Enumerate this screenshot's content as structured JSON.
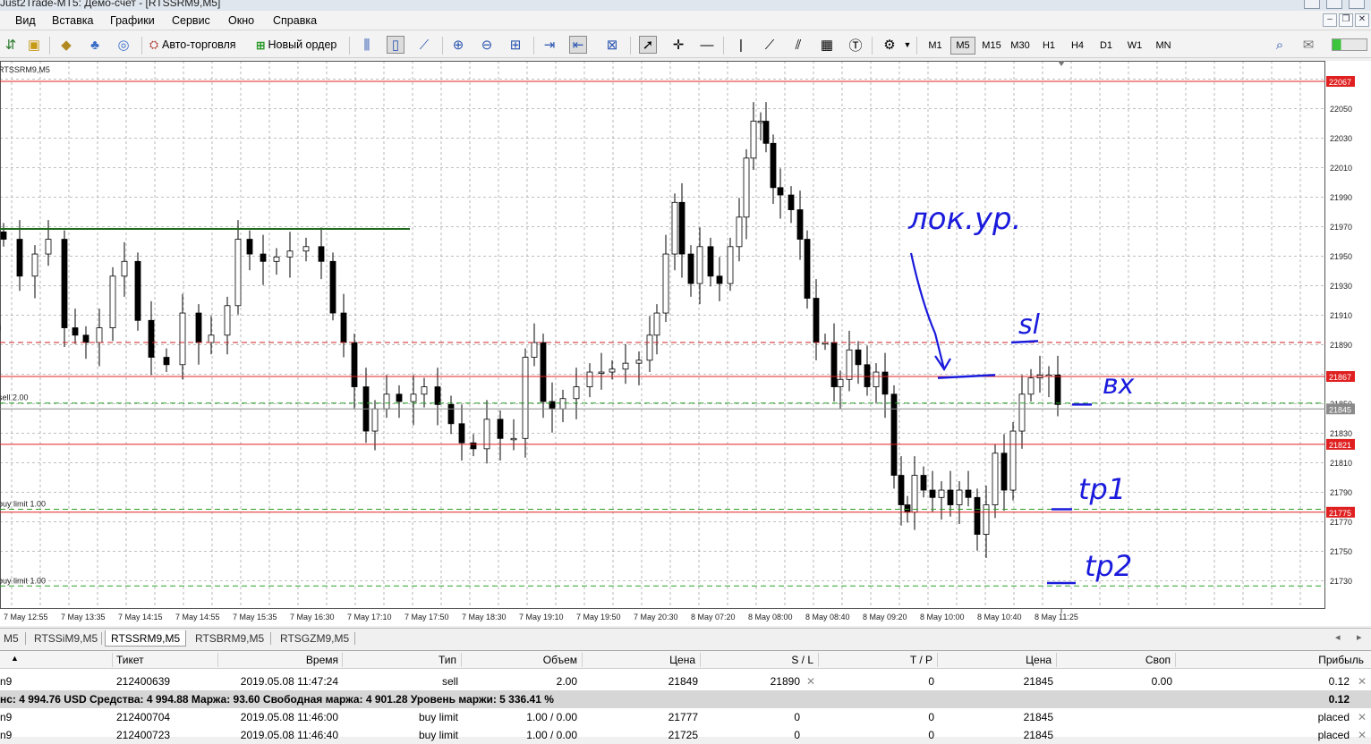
{
  "window": {
    "title": "Just2Trade-MT5: Демо-счет - [RTSSRM9,M5]"
  },
  "menu": [
    "Вид",
    "Вставка",
    "Графики",
    "Сервис",
    "Окно",
    "Справка"
  ],
  "toolbar": {
    "auto_trading": "Авто-торговля",
    "new_order": "Новый ордер",
    "timeframes": [
      "M1",
      "M5",
      "M15",
      "M30",
      "H1",
      "H4",
      "D1",
      "W1",
      "MN"
    ],
    "active_timeframe": "M5"
  },
  "chart": {
    "symbol_label": "RTSSRM9,M5",
    "price_labels": [
      "22070",
      "22050",
      "22030",
      "22010",
      "21990",
      "21970",
      "21950",
      "21930",
      "21910",
      "21890",
      "21870",
      "21850",
      "21830",
      "21810",
      "21790",
      "21770",
      "21750",
      "21730"
    ],
    "time_labels": [
      "7 May 12:55",
      "7 May 13:35",
      "7 May 14:15",
      "7 May 14:55",
      "7 May 15:35",
      "7 May 16:30",
      "7 May 17:10",
      "7 May 17:50",
      "7 May 18:30",
      "7 May 19:10",
      "7 May 19:50",
      "7 May 20:30",
      "8 May 07:20",
      "8 May 08:00",
      "8 May 08:40",
      "8 May 09:20",
      "8 May 10:00",
      "8 May 10:40",
      "8 May 11:25"
    ],
    "levels": [
      {
        "price": 22067,
        "label": "22067",
        "color": "#e02020",
        "style": "solid"
      },
      {
        "price": 21890,
        "label": "",
        "color": "#cc2020",
        "style": "dash"
      },
      {
        "price": 21867,
        "label": "21867",
        "color": "#e02020",
        "style": "solid"
      },
      {
        "price": 21845,
        "label": "21845",
        "color": "#8a8a8a",
        "style": "solid"
      },
      {
        "price": 21821,
        "label": "21821",
        "color": "#e02020",
        "style": "solid"
      },
      {
        "price": 21775,
        "label": "21775",
        "color": "#e02020",
        "style": "solid"
      }
    ],
    "order_lines": [
      {
        "price": 21849,
        "label": "sell 2.00",
        "color": "#2aa02a"
      },
      {
        "price": 21777,
        "label": "buy limit 1.00",
        "color": "#2aa02a"
      },
      {
        "price": 21725,
        "label": "buy limit 1.00",
        "color": "#2aa02a"
      }
    ],
    "left_marker": "l",
    "colors": {
      "bull": "#ffffff",
      "bear": "#000000",
      "grid": "#9a9a9a",
      "hline": "#1d6a1d",
      "ink": "#1a1adc"
    }
  },
  "handwriting": {
    "level_note": "лок.ур.",
    "sl": "sl",
    "entry": "вх",
    "tp1": "tp1",
    "tp2": "tp2"
  },
  "tabs": [
    "M5",
    "RTSSiM9,M5",
    "RTSSRM9,M5",
    "RTSBRM9,M5",
    "RTSGZM9,M5"
  ],
  "active_tab": "RTSSRM9,M5",
  "terminal": {
    "columns": [
      "Тикет",
      "Время",
      "Тип",
      "Объем",
      "Цена",
      "S / L",
      "T / P",
      "Цена",
      "Своп",
      "Прибыль"
    ],
    "rows": [
      {
        "symbol": "n9",
        "ticket": "212400639",
        "time": "2019.05.08 11:47:24",
        "type": "sell",
        "volume": "2.00",
        "price": "21849",
        "sl": "21890",
        "tp": "0",
        "cur": "21845",
        "swap": "0.00",
        "profit": "0.12"
      },
      {
        "symbol": "n9",
        "ticket": "212400704",
        "time": "2019.05.08 11:46:00",
        "type": "buy limit",
        "volume": "1.00 / 0.00",
        "price": "21777",
        "sl": "0",
        "tp": "0",
        "cur": "21845",
        "swap": "",
        "profit": "placed"
      },
      {
        "symbol": "n9",
        "ticket": "212400723",
        "time": "2019.05.08 11:46:40",
        "type": "buy limit",
        "volume": "1.00 / 0.00",
        "price": "21725",
        "sl": "0",
        "tp": "0",
        "cur": "21845",
        "swap": "",
        "profit": "placed"
      }
    ],
    "summary": "нс: 4 994.76 USD  Средства: 4 994.88  Маржа: 93.60  Свободная маржа: 4 901.28  Уровень маржи: 5 336.41 %",
    "summary_profit": "0.12"
  }
}
